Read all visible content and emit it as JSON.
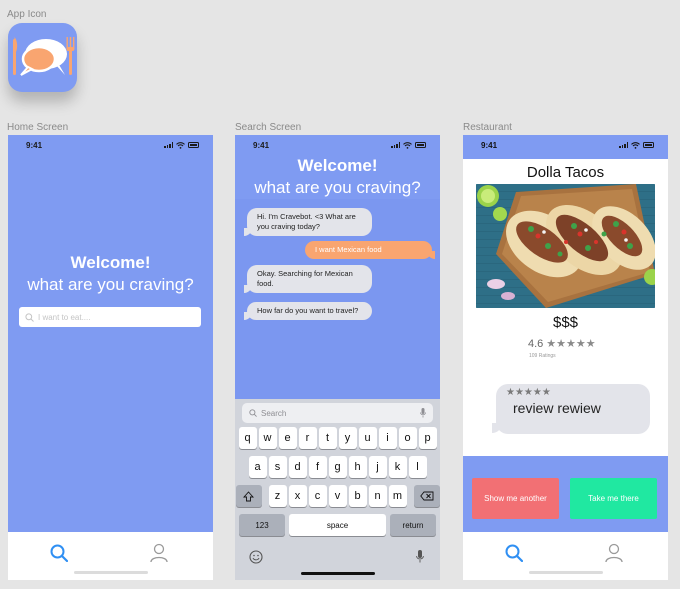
{
  "labels": {
    "app_icon": "App Icon",
    "home_screen": "Home Screen",
    "search_screen": "Search Screen",
    "restaurant": "Restaurant"
  },
  "status": {
    "time": "9:41"
  },
  "home": {
    "welcome": "Welcome!",
    "subtitle": "what are you craving?",
    "search_placeholder": "I want to eat...."
  },
  "search_screen": {
    "welcome": "Welcome!",
    "subtitle": "what are you craving?",
    "messages": [
      {
        "from": "bot",
        "text": "Hi. I'm Cravebot. <3 What are you craving today?"
      },
      {
        "from": "user",
        "text": "I want Mexican food"
      },
      {
        "from": "bot",
        "text": "Okay. Searching for Mexican food."
      },
      {
        "from": "bot",
        "text": "How far do you want to travel?"
      }
    ],
    "keyboard": {
      "search_placeholder": "Search",
      "row1": [
        "q",
        "w",
        "e",
        "r",
        "t",
        "y",
        "u",
        "i",
        "o",
        "p"
      ],
      "row2": [
        "a",
        "s",
        "d",
        "f",
        "g",
        "h",
        "j",
        "k",
        "l"
      ],
      "row3": [
        "z",
        "x",
        "c",
        "v",
        "b",
        "n",
        "m"
      ],
      "numbers_key": "123",
      "space_key": "space",
      "return_key": "return"
    }
  },
  "restaurant_screen": {
    "name": "Dolla Tacos",
    "price": "$$$",
    "rating": "4.6",
    "rating_stars": 4.5,
    "rating_count": "109 Ratings",
    "review_stars": 4.5,
    "review_text": "review rewiew",
    "buttons": {
      "show_another": "Show me another",
      "take_me_there": "Take me there"
    }
  },
  "colors": {
    "primary_blue": "#7f9bf2",
    "user_bubble": "#f9a570",
    "bot_bubble": "#e3e4ea",
    "show_another_button": "#f27074",
    "take_me_there_button": "#20e8a1",
    "tab_active": "#2f8ff3",
    "tab_inactive": "#9a9a9a"
  },
  "icons": {
    "app_icon": "chat-bubbles-fork-knife-icon",
    "tab_search": "search-icon",
    "tab_profile": "person-icon"
  }
}
